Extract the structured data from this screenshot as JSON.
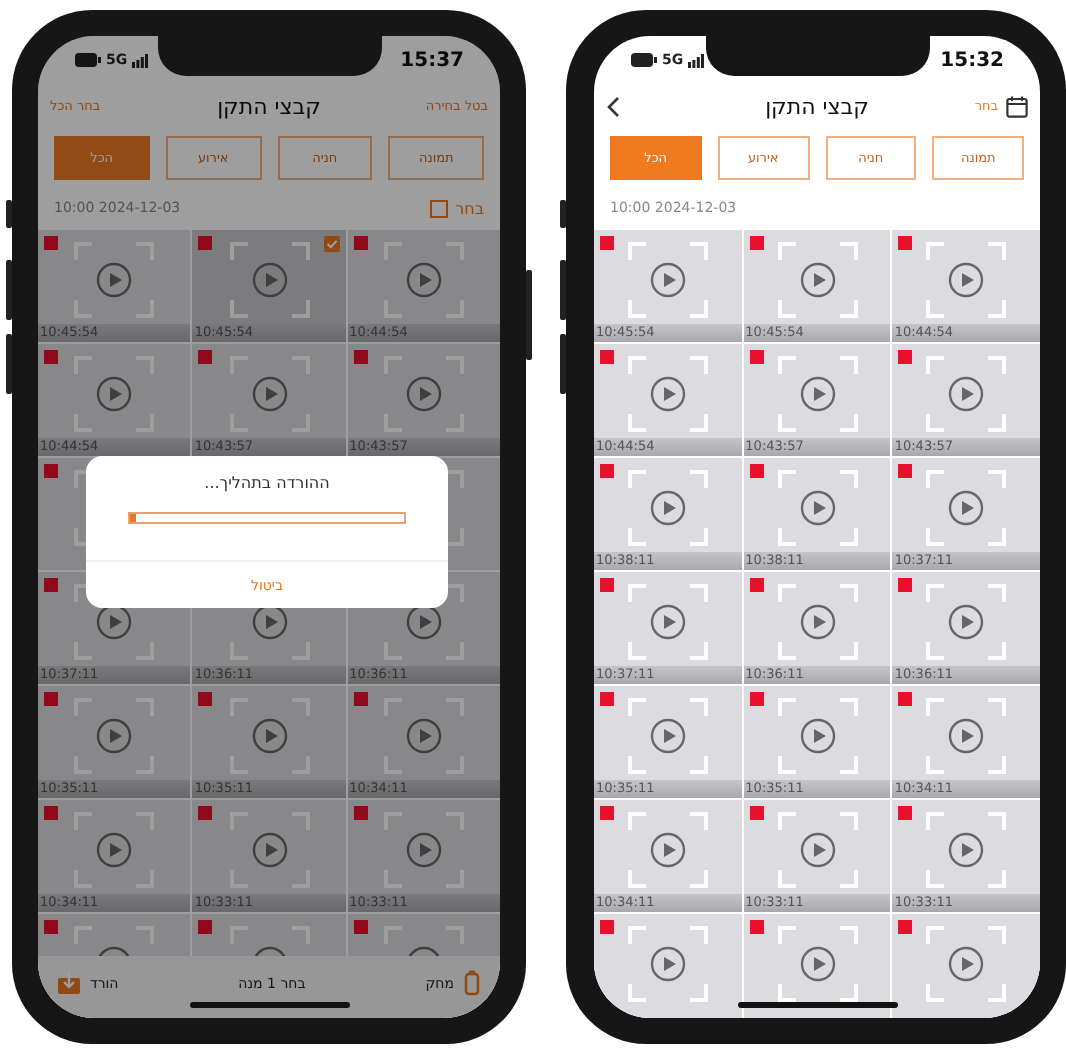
{
  "phones": [
    {
      "status": {
        "time": "15:32",
        "network": "5G"
      },
      "header": {
        "title": "קבצי התקן",
        "start_action": "בחר",
        "back": true,
        "calendar": true
      },
      "tabs": [
        {
          "label": "תמונה",
          "selected": false
        },
        {
          "label": "חניה",
          "selected": false
        },
        {
          "label": "אירוע",
          "selected": false
        },
        {
          "label": "הכל",
          "selected": true
        }
      ],
      "date": "2024-12-03 10:00",
      "cells": [
        {
          "time": "10:44:54",
          "badge": true
        },
        {
          "time": "10:45:54",
          "badge": true
        },
        {
          "time": "10:45:54",
          "badge": true
        },
        {
          "time": "10:43:57",
          "badge": true
        },
        {
          "time": "10:43:57",
          "badge": true
        },
        {
          "time": "10:44:54",
          "badge": true
        },
        {
          "time": "10:37:11",
          "badge": true
        },
        {
          "time": "10:38:11",
          "badge": true
        },
        {
          "time": "10:38:11",
          "badge": true
        },
        {
          "time": "10:36:11",
          "badge": true
        },
        {
          "time": "10:36:11",
          "badge": true
        },
        {
          "time": "10:37:11",
          "badge": true
        },
        {
          "time": "10:34:11",
          "badge": true
        },
        {
          "time": "10:35:11",
          "badge": true
        },
        {
          "time": "10:35:11",
          "badge": true
        },
        {
          "time": "10:33:11",
          "badge": true
        },
        {
          "time": "10:33:11",
          "badge": true
        },
        {
          "time": "10:34:11",
          "badge": true
        },
        {
          "badge": true
        },
        {
          "badge": true
        },
        {
          "badge": true
        }
      ]
    },
    {
      "status": {
        "time": "15:37",
        "network": "5G"
      },
      "header": {
        "title": "קבצי התקן",
        "start_action": "בטל בחירה",
        "end_action": "בחר הכל"
      },
      "tabs": [
        {
          "label": "תמונה",
          "selected": false
        },
        {
          "label": "חניה",
          "selected": false
        },
        {
          "label": "אירוע",
          "selected": false
        },
        {
          "label": "הכל",
          "selected": true
        }
      ],
      "date": "2024-12-03 10:00",
      "select_label": "בחר",
      "select_checked": false,
      "cells": [
        {
          "time": "10:44:54",
          "badge": true,
          "selected": false
        },
        {
          "time": "10:45:54",
          "badge": true,
          "selected": true
        },
        {
          "time": "10:45:54",
          "badge": true,
          "selected": false
        },
        {
          "time": "10:43:57",
          "badge": true,
          "selected": false
        },
        {
          "time": "10:43:57",
          "badge": true,
          "selected": false
        },
        {
          "time": "10:44:54",
          "badge": true,
          "selected": false
        },
        {
          "badge": false,
          "selected": false
        },
        null,
        {
          "badge": true
        },
        {
          "time": "10:36:11",
          "badge": false,
          "selected": false
        },
        {
          "time": "10:36:11",
          "badge": false,
          "selected": false
        },
        {
          "time": "10:37:11",
          "badge": true,
          "selected": false
        },
        {
          "time": "10:34:11",
          "badge": true,
          "selected": false
        },
        {
          "time": "10:35:11",
          "badge": true,
          "selected": false
        },
        {
          "time": "10:35:11",
          "badge": true,
          "selected": false
        },
        {
          "time": "10:33:11",
          "badge": true,
          "selected": false
        },
        {
          "time": "10:33:11",
          "badge": true,
          "selected": false
        },
        {
          "time": "10:34:11",
          "badge": true,
          "selected": false
        },
        {
          "badge": true,
          "selected": false
        },
        {
          "badge": true,
          "selected": false
        },
        {
          "badge": true,
          "selected": false
        }
      ],
      "bottom_bar": {
        "delete": "מחק",
        "status": "בחר 1 מנה",
        "download": "הורד"
      },
      "dialog": {
        "title": "ההורדה בתהליך...",
        "level": 0.02,
        "cancel": "ביטול"
      }
    }
  ]
}
